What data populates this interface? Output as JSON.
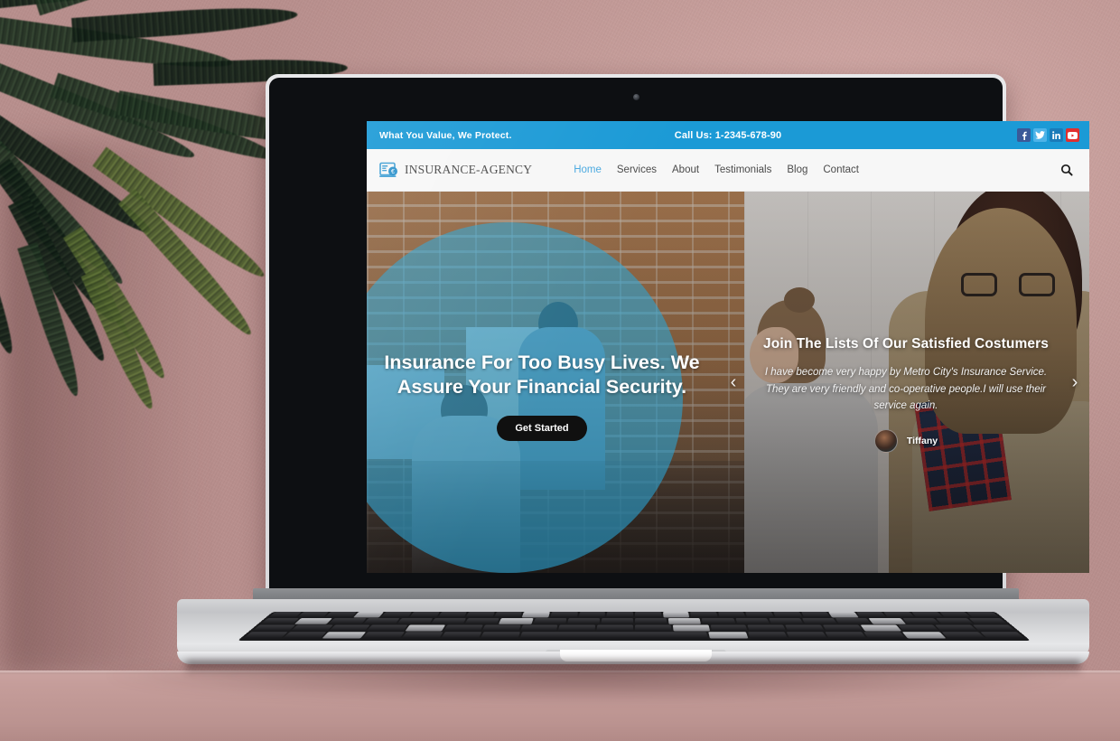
{
  "scene": {
    "description": "laptop-on-desk-mockup",
    "wall_color": "#c49c99",
    "plant": "palm-fronds",
    "device": "silver-laptop"
  },
  "site": {
    "topbar": {
      "tagline": "What You Value, We Protect.",
      "phone": "Call Us: 1-2345-678-90",
      "bg_color": "#1b9ad6",
      "socials": [
        {
          "name": "facebook",
          "glyph": "f",
          "color": "#3b5998"
        },
        {
          "name": "twitter",
          "glyph": "t",
          "color": "#4db3e8"
        },
        {
          "name": "linkedin",
          "glyph": "in",
          "color": "#1a7bb9"
        },
        {
          "name": "youtube",
          "glyph": "y",
          "color": "#e02f2f"
        }
      ]
    },
    "navbar": {
      "brand": "INSURANCE-AGENCY",
      "brand_icon": "insurance-card-icon",
      "search_icon": "search-icon",
      "accent_color": "#4aa9e0",
      "items": [
        {
          "label": "Home",
          "active": true
        },
        {
          "label": "Services",
          "active": false
        },
        {
          "label": "About",
          "active": false
        },
        {
          "label": "Testimonials",
          "active": false
        },
        {
          "label": "Blog",
          "active": false
        },
        {
          "label": "Contact",
          "active": false
        }
      ]
    },
    "hero": {
      "headline": "Insurance For Too Busy Lives. We Assure Your Financial Security.",
      "cta_label": "Get Started",
      "circle_color": "#2aa6d7",
      "testimonial": {
        "title": "Join The Lists Of Our Satisfied Costumers",
        "quote": "I have become very happy by Metro City's Insurance Service. They are very friendly and co-operative people.I will use their service again.",
        "author": "Tiffany",
        "prev_icon": "chevron-left-icon",
        "next_icon": "chevron-right-icon"
      }
    }
  }
}
